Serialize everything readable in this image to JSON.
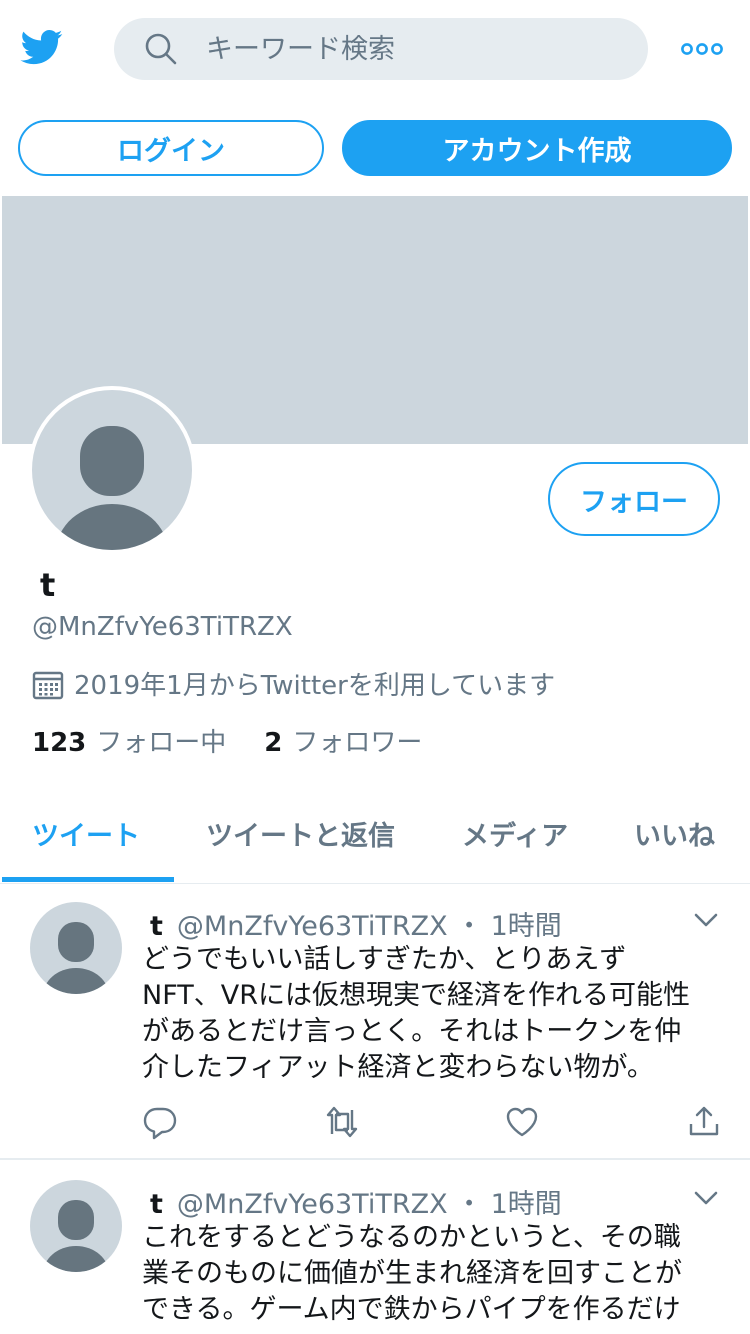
{
  "header": {
    "search_placeholder": "キーワード検索",
    "login_label": "ログイン",
    "signup_label": "アカウント作成"
  },
  "profile": {
    "follow_label": "フォロー",
    "display_name": "t",
    "handle": "@MnZfvYe63TiTRZX",
    "joined": "2019年1月からTwitterを利用しています",
    "following_count": "123",
    "following_label": "フォロー中",
    "followers_count": "2",
    "followers_label": "フォロワー"
  },
  "tabs": [
    {
      "label": "ツイート",
      "active": true
    },
    {
      "label": "ツイートと返信",
      "active": false
    },
    {
      "label": "メディア",
      "active": false
    },
    {
      "label": "いいね",
      "active": false
    }
  ],
  "tweets": [
    {
      "name": "t",
      "handle": "@MnZfvYe63TiTRZX",
      "separator": "・",
      "time": "1時間",
      "lines": [
        "どうでもいい話しすぎたか、とりあえず",
        "NFT、VRには仮想現実で経済を作れる可能性",
        "があるとだけ言っとく。それはトークンを仲",
        "介したフィアット経済と変わらない物が。"
      ]
    },
    {
      "name": "t",
      "handle": "@MnZfvYe63TiTRZX",
      "separator": "・",
      "time": "1時間",
      "lines": [
        "これをするとどうなるのかというと、その職",
        "業そのものに価値が生まれ経済を回すことが",
        "できる。ゲーム内で鉄からパイプを作るだけ"
      ]
    }
  ],
  "colors": {
    "accent": "#1da1f2",
    "muted_text": "#657786",
    "banner": "#ccd6dd",
    "avatar_silhouette": "#66757f"
  },
  "icons": [
    "twitter-bird-icon",
    "search-icon",
    "more-dots-icon",
    "calendar-icon",
    "chevron-down-icon",
    "reply-icon",
    "retweet-icon",
    "like-icon",
    "share-icon"
  ]
}
